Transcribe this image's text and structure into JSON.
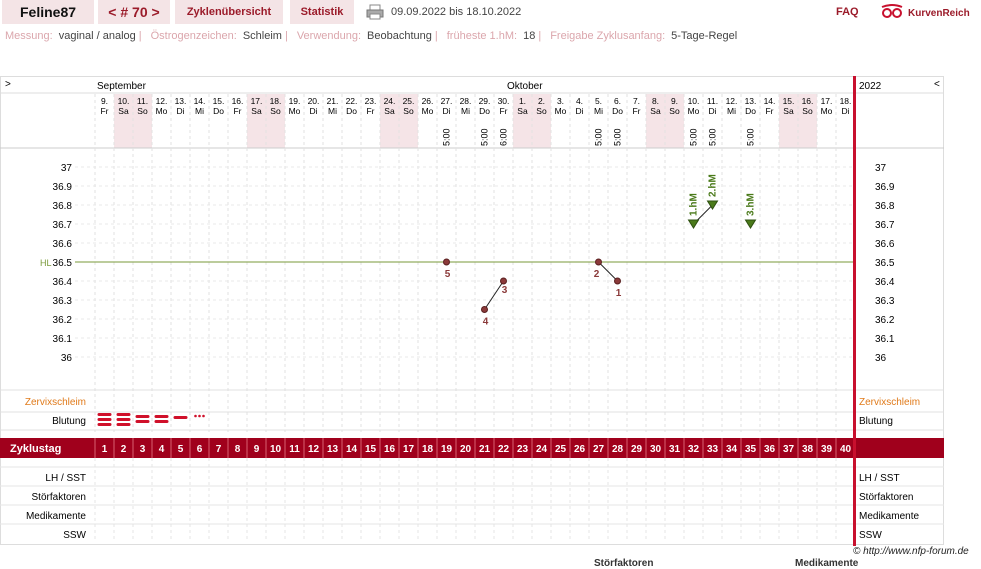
{
  "header": {
    "username": "Feline87",
    "cycle_nav": "< # 70 >",
    "tabs": [
      "Zyklenübersicht",
      "Statistik"
    ],
    "date_range": "09.09.2022 bis 18.10.2022",
    "faq": "FAQ",
    "logo_text": "KurvenReich"
  },
  "settings": [
    {
      "label": "Messung:",
      "value": "vaginal / analog"
    },
    {
      "label": "Östrogenzeichen:",
      "value": "Schleim"
    },
    {
      "label": "Verwendung:",
      "value": "Beobachtung"
    },
    {
      "label": "früheste 1.hM:",
      "value": "18"
    },
    {
      "label": "Freigabe Zyklusanfang:",
      "value": "5-Tage-Regel"
    }
  ],
  "chart": {
    "nav_prev": ">",
    "nav_next": "<",
    "months": [
      {
        "name": "September",
        "day_index": 0
      },
      {
        "name": "Oktober",
        "day_index": 22
      }
    ],
    "year": "2022",
    "days": [
      {
        "d": "9.",
        "w": "Fr"
      },
      {
        "d": "10.",
        "w": "Sa"
      },
      {
        "d": "11.",
        "w": "So"
      },
      {
        "d": "12.",
        "w": "Mo"
      },
      {
        "d": "13.",
        "w": "Di"
      },
      {
        "d": "14.",
        "w": "Mi"
      },
      {
        "d": "15.",
        "w": "Do"
      },
      {
        "d": "16.",
        "w": "Fr"
      },
      {
        "d": "17.",
        "w": "Sa"
      },
      {
        "d": "18.",
        "w": "So"
      },
      {
        "d": "19.",
        "w": "Mo"
      },
      {
        "d": "20.",
        "w": "Di"
      },
      {
        "d": "21.",
        "w": "Mi"
      },
      {
        "d": "22.",
        "w": "Do"
      },
      {
        "d": "23.",
        "w": "Fr"
      },
      {
        "d": "24.",
        "w": "Sa"
      },
      {
        "d": "25.",
        "w": "So"
      },
      {
        "d": "26.",
        "w": "Mo"
      },
      {
        "d": "27.",
        "w": "Di"
      },
      {
        "d": "28.",
        "w": "Mi"
      },
      {
        "d": "29.",
        "w": "Do"
      },
      {
        "d": "30.",
        "w": "Fr"
      },
      {
        "d": "1.",
        "w": "Sa"
      },
      {
        "d": "2.",
        "w": "So"
      },
      {
        "d": "3.",
        "w": "Mo"
      },
      {
        "d": "4.",
        "w": "Di"
      },
      {
        "d": "5.",
        "w": "Mi"
      },
      {
        "d": "6.",
        "w": "Do"
      },
      {
        "d": "7.",
        "w": "Fr"
      },
      {
        "d": "8.",
        "w": "Sa"
      },
      {
        "d": "9.",
        "w": "So"
      },
      {
        "d": "10.",
        "w": "Mo"
      },
      {
        "d": "11.",
        "w": "Di"
      },
      {
        "d": "12.",
        "w": "Mi"
      },
      {
        "d": "13.",
        "w": "Do"
      },
      {
        "d": "14.",
        "w": "Fr"
      },
      {
        "d": "15.",
        "w": "Sa"
      },
      {
        "d": "16.",
        "w": "So"
      },
      {
        "d": "17.",
        "w": "Mo"
      },
      {
        "d": "18.",
        "w": "Di"
      }
    ],
    "times": [
      {
        "day": 19,
        "time": "5:00"
      },
      {
        "day": 21,
        "time": "5:00"
      },
      {
        "day": 22,
        "time": "6:00"
      },
      {
        "day": 27,
        "time": "5:00"
      },
      {
        "day": 28,
        "time": "5:00"
      },
      {
        "day": 32,
        "time": "5:00"
      },
      {
        "day": 33,
        "time": "5:00"
      },
      {
        "day": 35,
        "time": "5:00"
      }
    ],
    "y_ticks": [
      "37",
      "36.9",
      "36.8",
      "36.7",
      "36.6",
      "36.5",
      "36.4",
      "36.3",
      "36.2",
      "36.1",
      "36"
    ],
    "hl_label": "HL",
    "hl_value": 36.5,
    "cycle_days": [
      "1",
      "2",
      "3",
      "4",
      "5",
      "6",
      "7",
      "8",
      "9",
      "10",
      "11",
      "12",
      "13",
      "14",
      "15",
      "16",
      "17",
      "18",
      "19",
      "20",
      "21",
      "22",
      "23",
      "24",
      "25",
      "26",
      "27",
      "28",
      "29",
      "30",
      "31",
      "32",
      "33",
      "34",
      "35",
      "36",
      "37",
      "38",
      "39",
      "40"
    ],
    "row_labels": {
      "cervix": "Zervixschleim",
      "bleeding": "Blutung",
      "cycle_day": "Zyklustag",
      "lh": "LH / SST",
      "disruptors": "Störfaktoren",
      "medication": "Medikamente",
      "ssw": "SSW"
    }
  },
  "chart_data": {
    "type": "scatter",
    "y_range": [
      36.0,
      37.0
    ],
    "coverline": 36.5,
    "series": [
      {
        "points": [
          {
            "cycle_day": 19,
            "temp": 36.5,
            "label": "5"
          },
          {
            "cycle_day": 21,
            "temp": 36.25,
            "label": "4"
          },
          {
            "cycle_day": 22,
            "temp": 36.4,
            "label": "3"
          },
          {
            "cycle_day": 27,
            "temp": 36.5,
            "label": "2"
          },
          {
            "cycle_day": 28,
            "temp": 36.4,
            "label": "1"
          },
          {
            "cycle_day": 32,
            "temp": 36.7,
            "label": "1.hM"
          },
          {
            "cycle_day": 33,
            "temp": 36.8,
            "label": "2.hM"
          },
          {
            "cycle_day": 35,
            "temp": 36.7,
            "label": "3.hM"
          }
        ]
      }
    ],
    "connections": [
      [
        21,
        22
      ],
      [
        27,
        28
      ],
      [
        32,
        33
      ]
    ],
    "bleeding": [
      {
        "cycle_day": 1,
        "level": "heavy"
      },
      {
        "cycle_day": 2,
        "level": "heavy"
      },
      {
        "cycle_day": 3,
        "level": "medium"
      },
      {
        "cycle_day": 4,
        "level": "medium"
      },
      {
        "cycle_day": 5,
        "level": "light"
      },
      {
        "cycle_day": 6,
        "level": "spotting"
      }
    ]
  },
  "footer": "© http://www.nfp-forum.de",
  "bottom_labels": [
    "Störfaktoren",
    "Medikamente"
  ],
  "colors": {
    "accent": "#9b1b2a",
    "cycle_bar": "#a0001c",
    "weekend": "#f5e4e7",
    "hl_line": "#7a9a3a",
    "temp_dot": "#8b3a3a",
    "hm_marker": "#4a7a1a"
  }
}
